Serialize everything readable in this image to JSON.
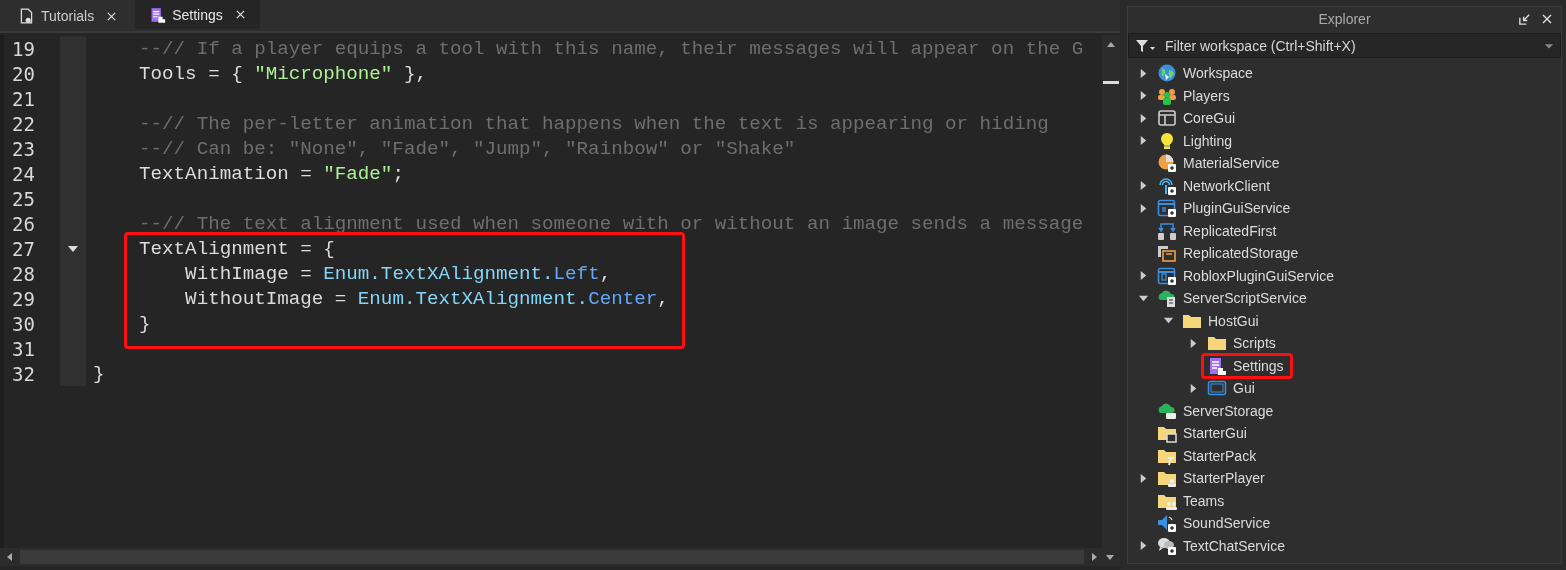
{
  "tabs": [
    {
      "label": "Tutorials",
      "kind": "document",
      "selected": false
    },
    {
      "label": "Settings",
      "kind": "module",
      "selected": true
    }
  ],
  "editor": {
    "blocks": [
      {
        "highlighted": false,
        "lines": [
          {
            "number": "19",
            "tokens": [
              {
                "kind": "comment",
                "text": "    --// If a player equips a tool with this name, their messages will appear on the G"
              }
            ]
          },
          {
            "number": "20",
            "tokens": [
              {
                "kind": "plain",
                "text": "    Tools = { "
              },
              {
                "kind": "string",
                "text": "\"Microphone\""
              },
              {
                "kind": "plain",
                "text": " },"
              }
            ]
          },
          {
            "number": "21"
          },
          {
            "number": "22",
            "tokens": [
              {
                "kind": "comment",
                "text": "    --// The per-letter animation that happens when the text is appearing or hiding"
              }
            ]
          },
          {
            "number": "23",
            "tokens": [
              {
                "kind": "comment",
                "text": "    --// Can be: \"None\", \"Fade\", \"Jump\", \"Rainbow\" or \"Shake\""
              }
            ]
          },
          {
            "number": "24",
            "tokens": [
              {
                "kind": "plain",
                "text": "    TextAnimation = "
              },
              {
                "kind": "string",
                "text": "\"Fade\""
              },
              {
                "kind": "plain",
                "text": ";"
              }
            ]
          },
          {
            "number": "25"
          },
          {
            "number": "26",
            "tokens": [
              {
                "kind": "comment",
                "text": "    --// The text alignment used when someone with or without an image sends a message"
              }
            ]
          }
        ]
      },
      {
        "highlighted": true,
        "lines": [
          {
            "number": "27",
            "expanded": true,
            "tokens": [
              {
                "kind": "plain",
                "text": "    TextAlignment = {"
              }
            ]
          },
          {
            "number": "28",
            "tokens": [
              {
                "kind": "plain",
                "text": "        WithImage = "
              },
              {
                "kind": "enum",
                "text": "Enum.TextXAlignment."
              },
              {
                "kind": "member",
                "text": "Left"
              },
              {
                "kind": "plain",
                "text": ","
              }
            ]
          },
          {
            "number": "29",
            "tokens": [
              {
                "kind": "plain",
                "text": "        WithoutImage = "
              },
              {
                "kind": "enum",
                "text": "Enum.TextXAlignment."
              },
              {
                "kind": "member",
                "text": "Center"
              },
              {
                "kind": "plain",
                "text": ","
              }
            ]
          },
          {
            "number": "30",
            "tokens": [
              {
                "kind": "plain",
                "text": "    }"
              }
            ]
          }
        ]
      },
      {
        "highlighted": false,
        "lines": [
          {
            "number": "31"
          },
          {
            "number": "32",
            "tokens": [
              {
                "kind": "plain",
                "text": "}"
              }
            ]
          }
        ]
      }
    ]
  },
  "explorer": {
    "title": "Explorer",
    "filter": {
      "placeholder": "Filter workspace (Ctrl+Shift+X)"
    },
    "items": [
      {
        "label": "Workspace",
        "kind": "globe",
        "expandable": true,
        "expanded": false,
        "highlighted": false
      },
      {
        "label": "Players",
        "kind": "players",
        "expandable": true,
        "expanded": false,
        "highlighted": false
      },
      {
        "label": "CoreGui",
        "kind": "window",
        "expandable": true,
        "expanded": false,
        "highlighted": false
      },
      {
        "label": "Lighting",
        "kind": "bulb",
        "expandable": true,
        "expanded": false,
        "highlighted": false
      },
      {
        "label": "MaterialService",
        "kind": "material",
        "expandable": false,
        "highlighted": false
      },
      {
        "label": "NetworkClient",
        "kind": "network",
        "expandable": true,
        "expanded": false,
        "highlighted": false
      },
      {
        "label": "PluginGuiService",
        "kind": "plugin",
        "expandable": true,
        "expanded": false,
        "highlighted": false
      },
      {
        "label": "ReplicatedFirst",
        "kind": "replfirst",
        "expandable": false,
        "highlighted": false
      },
      {
        "label": "ReplicatedStorage",
        "kind": "replstorage",
        "expandable": false,
        "highlighted": false
      },
      {
        "label": "RobloxPluginGuiService",
        "kind": "robloxplugin",
        "expandable": true,
        "expanded": false,
        "highlighted": false
      },
      {
        "label": "ServerScriptService",
        "kind": "serverscript",
        "expandable": true,
        "expanded": true,
        "highlighted": false,
        "children": [
          {
            "label": "HostGui",
            "kind": "folder",
            "expandable": true,
            "expanded": true,
            "highlighted": false,
            "children": [
              {
                "label": "Scripts",
                "kind": "folder",
                "expandable": true,
                "expanded": false,
                "highlighted": false
              },
              {
                "label": "Settings",
                "kind": "module",
                "expandable": false,
                "highlighted": true
              },
              {
                "label": "Gui",
                "kind": "gui",
                "expandable": true,
                "expanded": false,
                "highlighted": false
              }
            ]
          }
        ]
      },
      {
        "label": "ServerStorage",
        "kind": "serverstorage",
        "expandable": false,
        "highlighted": false
      },
      {
        "label": "StarterGui",
        "kind": "startergui",
        "expandable": false,
        "highlighted": false
      },
      {
        "label": "StarterPack",
        "kind": "starterpack",
        "expandable": false,
        "highlighted": false
      },
      {
        "label": "StarterPlayer",
        "kind": "starterplayer",
        "expandable": true,
        "expanded": false,
        "highlighted": false
      },
      {
        "label": "Teams",
        "kind": "teams",
        "expandable": false,
        "highlighted": false
      },
      {
        "label": "SoundService",
        "kind": "sound",
        "expandable": false,
        "highlighted": false
      },
      {
        "label": "TextChatService",
        "kind": "textchat",
        "expandable": true,
        "expanded": false,
        "highlighted": false
      }
    ]
  }
}
